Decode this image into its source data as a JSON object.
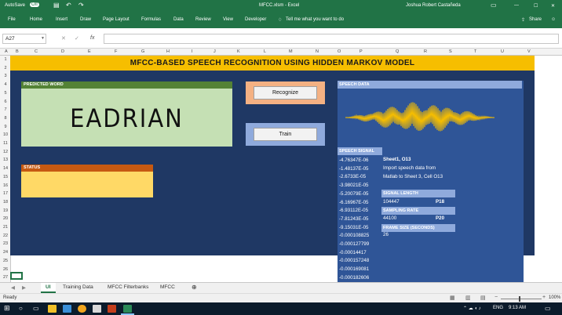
{
  "window": {
    "autosave_label": "AutoSave",
    "autosave_state": "Off",
    "file_title": "MFCC.xlsm - Excel",
    "user_name": "Joshua Robert Castañeda",
    "share_label": "Share"
  },
  "ribbon": {
    "tabs": [
      "File",
      "Home",
      "Insert",
      "Draw",
      "Page Layout",
      "Formulas",
      "Data",
      "Review",
      "View",
      "Developer"
    ],
    "tell_me": "Tell me what you want to do"
  },
  "formula_bar": {
    "name_box": "A27",
    "fx": "fx",
    "formula_value": ""
  },
  "columns": [
    "A",
    "B",
    "C",
    "D",
    "E",
    "F",
    "G",
    "H",
    "I",
    "J",
    "K",
    "L",
    "M",
    "N",
    "O",
    "P",
    "Q",
    "R",
    "S",
    "T",
    "U",
    "V"
  ],
  "rows": [
    "1",
    "2",
    "3",
    "4",
    "5",
    "6",
    "7",
    "8",
    "9",
    "10",
    "11",
    "12",
    "13",
    "14",
    "15",
    "16",
    "17",
    "18",
    "19",
    "20",
    "21",
    "22",
    "23",
    "24",
    "25",
    "26",
    "27"
  ],
  "dashboard": {
    "title": "MFCC-BASED SPEECH RECOGNITION USING HIDDEN MARKOV MODEL",
    "predicted_word_label": "PREDICTED WORD",
    "predicted_word": "EADRIAN",
    "status_label": "STATUS",
    "status_value": "",
    "recognize_button": "Recognize",
    "train_button": "Train",
    "speech_data_label": "SPEECH DATA",
    "speech_signal_label": "SPEECH SIGNAL",
    "signal_values": [
      "-4.76347E-06",
      "-1.48137E-05",
      "-2.6733E-05",
      "-3.98021E-05",
      "-5.20079E-05",
      "-6.16967E-05",
      "-6.93112E-05",
      "-7.81243E-05",
      "-9.15031E-05",
      "-0.000108825",
      "-0.000127799",
      "-0.00014417",
      "-0.000157248",
      "-0.000169081",
      "-0.000182606"
    ],
    "sheet_ref": "Sheet1, O13",
    "import_note_1": "Import speech data from",
    "import_note_2": "Matlab to Sheet 3, Cell O13",
    "signal_length_label": "SIGNAL LENGTH",
    "signal_length_value": "104447",
    "signal_length_ref": "P18",
    "sampling_rate_label": "SAMPLING RATE",
    "sampling_rate_value": "44100",
    "sampling_rate_ref": "P20",
    "frame_size_label": "FRAME SIZE (SECONDS)",
    "frame_size_value": "26"
  },
  "sheet_tabs": {
    "items": [
      "UI",
      "Training Data",
      "MFCC Filterbanks",
      "MFCC"
    ],
    "active": "UI"
  },
  "status_bar": {
    "ready": "Ready",
    "zoom": "100%"
  },
  "taskbar": {
    "lang": "ENG",
    "time": "9:13 AM"
  },
  "colors": {
    "excel_green": "#217346",
    "banner": "#f6be00",
    "navy": "#1f3864",
    "panel_blue": "#2f5597",
    "label_blue": "#8faadc",
    "waveform": "#f6be00"
  }
}
